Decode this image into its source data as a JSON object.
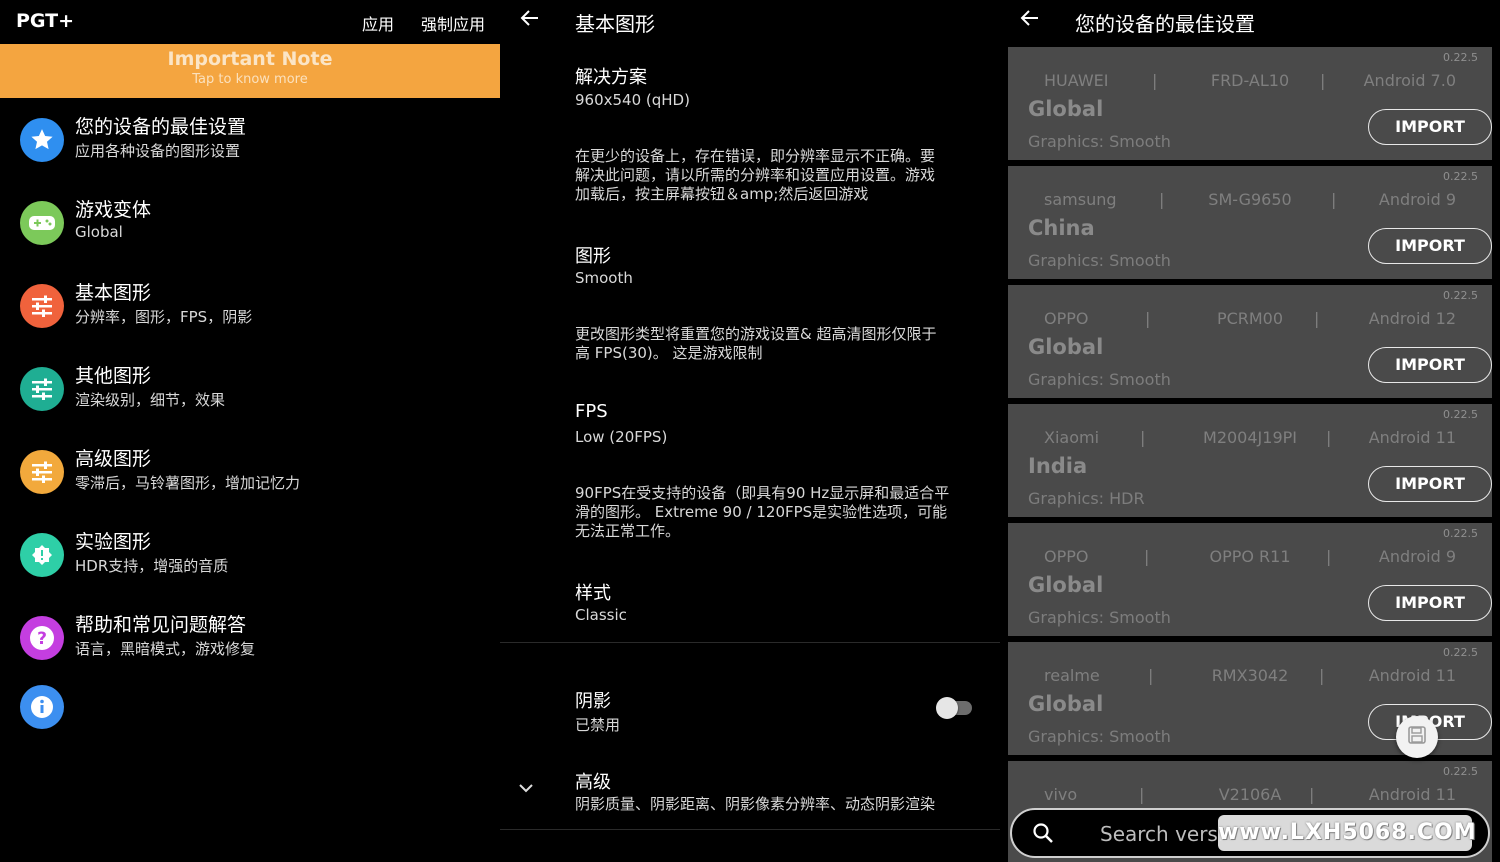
{
  "main_menu": {
    "app_title": "PGT+",
    "header_buttons": [
      "应用",
      "强制应用"
    ],
    "note": {
      "title": "Important Note",
      "subtitle": "Tap to know more",
      "color": "#f4a540"
    },
    "items": [
      {
        "title": "您的设备的最佳设置",
        "subtitle": "应用各种设备的图形设置",
        "icon": "star-icon",
        "color": "#2f8ff0"
      },
      {
        "title": "游戏变体",
        "subtitle": "Global",
        "icon": "gamepad-icon",
        "color": "#7cc95a"
      },
      {
        "title": "基本图形",
        "subtitle": "分辨率，图形，FPS，阴影",
        "icon": "sliders-icon",
        "color": "#f0623c"
      },
      {
        "title": "其他图形",
        "subtitle": "渲染级别，细节，效果",
        "icon": "sliders-icon",
        "color": "#1fae93"
      },
      {
        "title": "高级图形",
        "subtitle": "零滞后，马铃薯图形，增加记忆力",
        "icon": "sliders-icon",
        "color": "#f2a93c"
      },
      {
        "title": "实验图形",
        "subtitle": "HDR支持，增强的音质",
        "icon": "flask-icon",
        "color": "#2ecfa7"
      },
      {
        "title": "帮助和常见问题解答",
        "subtitle": "语言，黑暗模式，游戏修复",
        "icon": "question-icon",
        "color": "#c43ee0"
      },
      {
        "title": "",
        "subtitle": "",
        "icon": "info-icon",
        "color": "#3c8ff0"
      }
    ]
  },
  "basic_graphics": {
    "title": "基本图形",
    "settings": [
      {
        "title": "解决方案",
        "value": "960x540 (qHD)",
        "desc": [
          "在更少的设备上，存在错误，即分辨率显示不正确。要",
          "解决此问题，请以所需的分辨率和设置应用设置。游戏",
          "加载后，按主屏幕按钮＆amp;然后返回游戏"
        ]
      },
      {
        "title": "图形",
        "value": "Smooth",
        "desc": [
          "更改图形类型将重置您的游戏设置& 超高清图形仅限于",
          "高 FPS(30)。 这是游戏限制"
        ]
      },
      {
        "title": "FPS",
        "value": "Low (20FPS)",
        "desc": [
          "90FPS在受支持的设备（即具有90 Hz显示屏和最适合平",
          "滑的图形。 Extreme 90 / 120FPS是实验性选项，可能",
          "无法正常工作。"
        ]
      },
      {
        "title": "样式",
        "value": "Classic",
        "desc": []
      }
    ],
    "shadow": {
      "title": "阴影",
      "value": "已禁用",
      "enabled": false
    },
    "advanced": {
      "title": "高级",
      "value": "阴影质量、阴影距离、阴影像素分辨率、动态阴影渲染"
    }
  },
  "best_settings": {
    "title": "您的设备的最佳设置",
    "separator": "|",
    "import_label": "IMPORT",
    "cards": [
      {
        "version": "0.22.5",
        "brand": "HUAWEI",
        "model": "FRD-AL10",
        "android": "Android 7.0",
        "region": "Global",
        "graphics": "Graphics: Smooth"
      },
      {
        "version": "0.22.5",
        "brand": "samsung",
        "model": "SM-G9650",
        "android": "Android 9",
        "region": "China",
        "graphics": "Graphics: Smooth"
      },
      {
        "version": "0.22.5",
        "brand": "OPPO",
        "model": "PCRM00",
        "android": "Android 12",
        "region": "Global",
        "graphics": "Graphics: Smooth"
      },
      {
        "version": "0.22.5",
        "brand": "Xiaomi",
        "model": "M2004J19PI",
        "android": "Android 11",
        "region": "India",
        "graphics": "Graphics: HDR"
      },
      {
        "version": "0.22.5",
        "brand": "OPPO",
        "model": "OPPO R11",
        "android": "Android 9",
        "region": "Global",
        "graphics": "Graphics: Smooth"
      },
      {
        "version": "0.22.5",
        "brand": "realme",
        "model": "RMX3042",
        "android": "Android 11",
        "region": "Global",
        "graphics": "Graphics: Smooth"
      },
      {
        "version": "0.22.5",
        "brand": "vivo",
        "model": "V2106A",
        "android": "Android 11",
        "region": "",
        "graphics": ""
      }
    ],
    "search_placeholder": "Search versi",
    "watermark": "www.LXH5068.COM"
  }
}
